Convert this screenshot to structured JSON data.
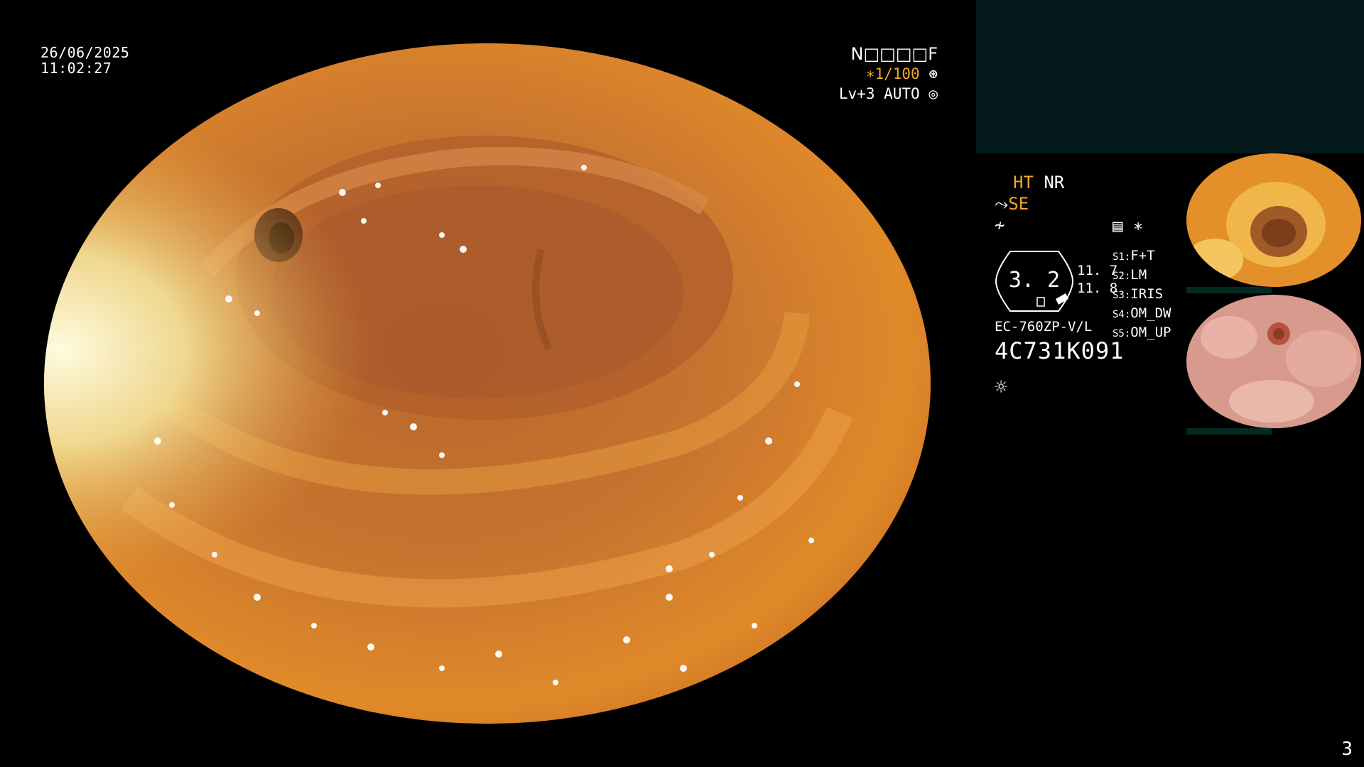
{
  "timestamp": {
    "date": "26/06/2025",
    "time": "11:02:27"
  },
  "status": {
    "mode_code": "N□□□□F",
    "shutter": "∗1/100",
    "shutter_icon": "shutter-icon",
    "iris_level": "Lv+3 AUTO",
    "iris_icon": "iris-icon"
  },
  "enhance": {
    "ht": "HT",
    "nr": "NR",
    "se": "SE",
    "se_icon": "structure-icon",
    "f_icon": "frequency-icon",
    "memory_icon": "memory-icon",
    "asterisk": "∗"
  },
  "zoom": {
    "value": "3. 2",
    "r1": "11. 7",
    "r2": "11. 8"
  },
  "switches": [
    {
      "key": "S1:",
      "value": "F+T"
    },
    {
      "key": "S2:",
      "value": "LM"
    },
    {
      "key": "S3:",
      "value": "IRIS"
    },
    {
      "key": "S4:",
      "value": "OM_DW"
    },
    {
      "key": "S5:",
      "value": "OM_UP"
    }
  ],
  "scope": {
    "model": "EC-760ZP-V/L",
    "serial": "4C731K091"
  },
  "light_icon": "light-icon",
  "thumbnails": [
    {
      "label": "thumbnail-1"
    },
    {
      "label": "thumbnail-2"
    }
  ],
  "page_number": "3",
  "colors": {
    "teal_box": "#03191a",
    "orange_text": "#f5a623",
    "tissue": "#d98a3c"
  }
}
